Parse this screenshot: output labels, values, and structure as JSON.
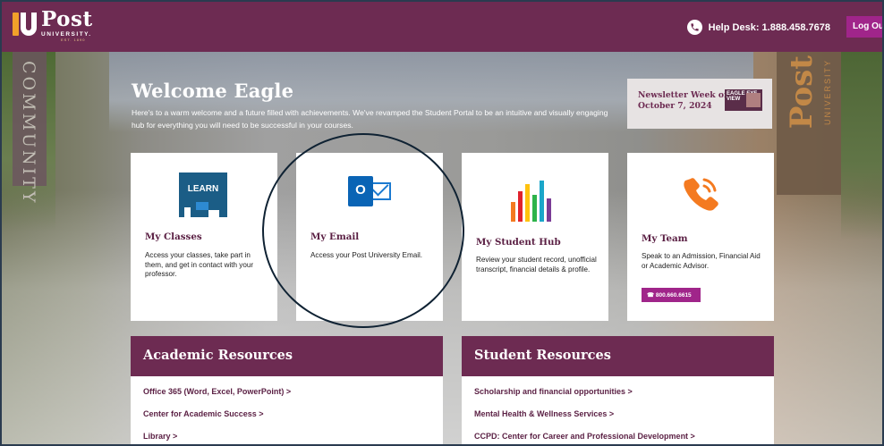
{
  "header": {
    "logo_text": "Post",
    "logo_sub": "UNIVERSITY.",
    "logo_est": "EST. 1890",
    "helpdesk": "Help Desk: 1.888.458.7678",
    "logout": "Log Out"
  },
  "hero": {
    "banner_left": "COMMUNITY",
    "banner_right": "Post",
    "banner_right_sub": "UNIVERSITY",
    "title": "Welcome Eagle",
    "intro": "Here's to a warm welcome and a future filled with achievements. We've revamped the Student Portal to be an intuitive and visually engaging hub for everything you will need to be successful in your courses."
  },
  "newsletter": {
    "line1": "Newsletter Week of",
    "line2": "October 7, 2024",
    "thumb_text": "EAGLE EYE VIEW"
  },
  "cards": [
    {
      "icon": "learn-icon",
      "icon_text": "LEARN",
      "title": "My Classes",
      "desc": "Access your classes, take part in them, and get in contact with your professor."
    },
    {
      "icon": "outlook-icon",
      "icon_text": "O",
      "title": "My Email",
      "desc": "Access your Post University Email."
    },
    {
      "icon": "bar-chart-icon",
      "title": "My Student Hub",
      "desc": "Review your student record, unofficial transcript, financial details & profile."
    },
    {
      "icon": "phone-icon",
      "title": "My Team",
      "desc": "Speak to an Admission, Financial Aid or Academic Advisor.",
      "phone": "800.660.6615"
    }
  ],
  "academic": {
    "title": "Academic Resources",
    "items": [
      "Office 365 (Word, Excel, PowerPoint) >",
      "Center for Academic Success >",
      "Library >"
    ]
  },
  "student": {
    "title": "Student Resources",
    "items": [
      "Scholarship and financial opportunities >",
      "Mental Health & Wellness Services >",
      "CCPD: Center for Career and Professional Development >"
    ]
  },
  "colors": {
    "brand": "#6d2b52",
    "accent": "#a0258a",
    "orange": "#f47a20"
  }
}
